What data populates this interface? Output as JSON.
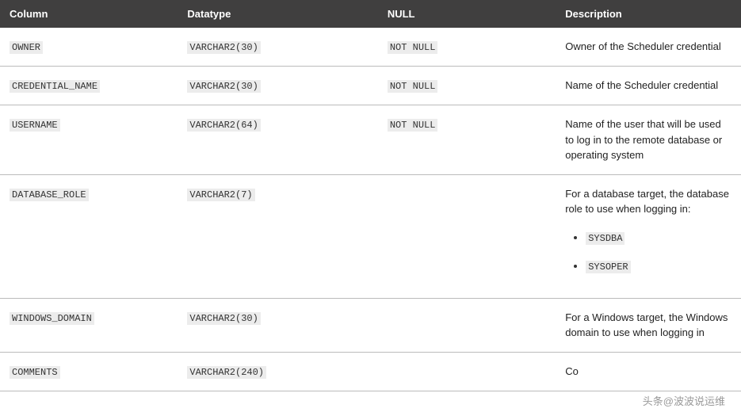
{
  "headers": {
    "column": "Column",
    "datatype": "Datatype",
    "null": "NULL",
    "description": "Description"
  },
  "rows": [
    {
      "column": "OWNER",
      "datatype": "VARCHAR2(30)",
      "null": "NOT NULL",
      "description": "Owner of the Scheduler credential"
    },
    {
      "column": "CREDENTIAL_NAME",
      "datatype": "VARCHAR2(30)",
      "null": "NOT NULL",
      "description": "Name of the Scheduler credential"
    },
    {
      "column": "USERNAME",
      "datatype": "VARCHAR2(64)",
      "null": "NOT NULL",
      "description": "Name of the user that will be used to log in to the remote database or operating system"
    },
    {
      "column": "DATABASE_ROLE",
      "datatype": "VARCHAR2(7)",
      "null": "",
      "description": "For a database target, the database role to use when logging in:",
      "list": [
        "SYSDBA",
        "SYSOPER"
      ]
    },
    {
      "column": "WINDOWS_DOMAIN",
      "datatype": "VARCHAR2(30)",
      "null": "",
      "description": "For a Windows target, the Windows domain to use when logging in"
    },
    {
      "column": "COMMENTS",
      "datatype": "VARCHAR2(240)",
      "null": "",
      "description": "Co"
    }
  ],
  "watermark": "头条@波波说运维"
}
